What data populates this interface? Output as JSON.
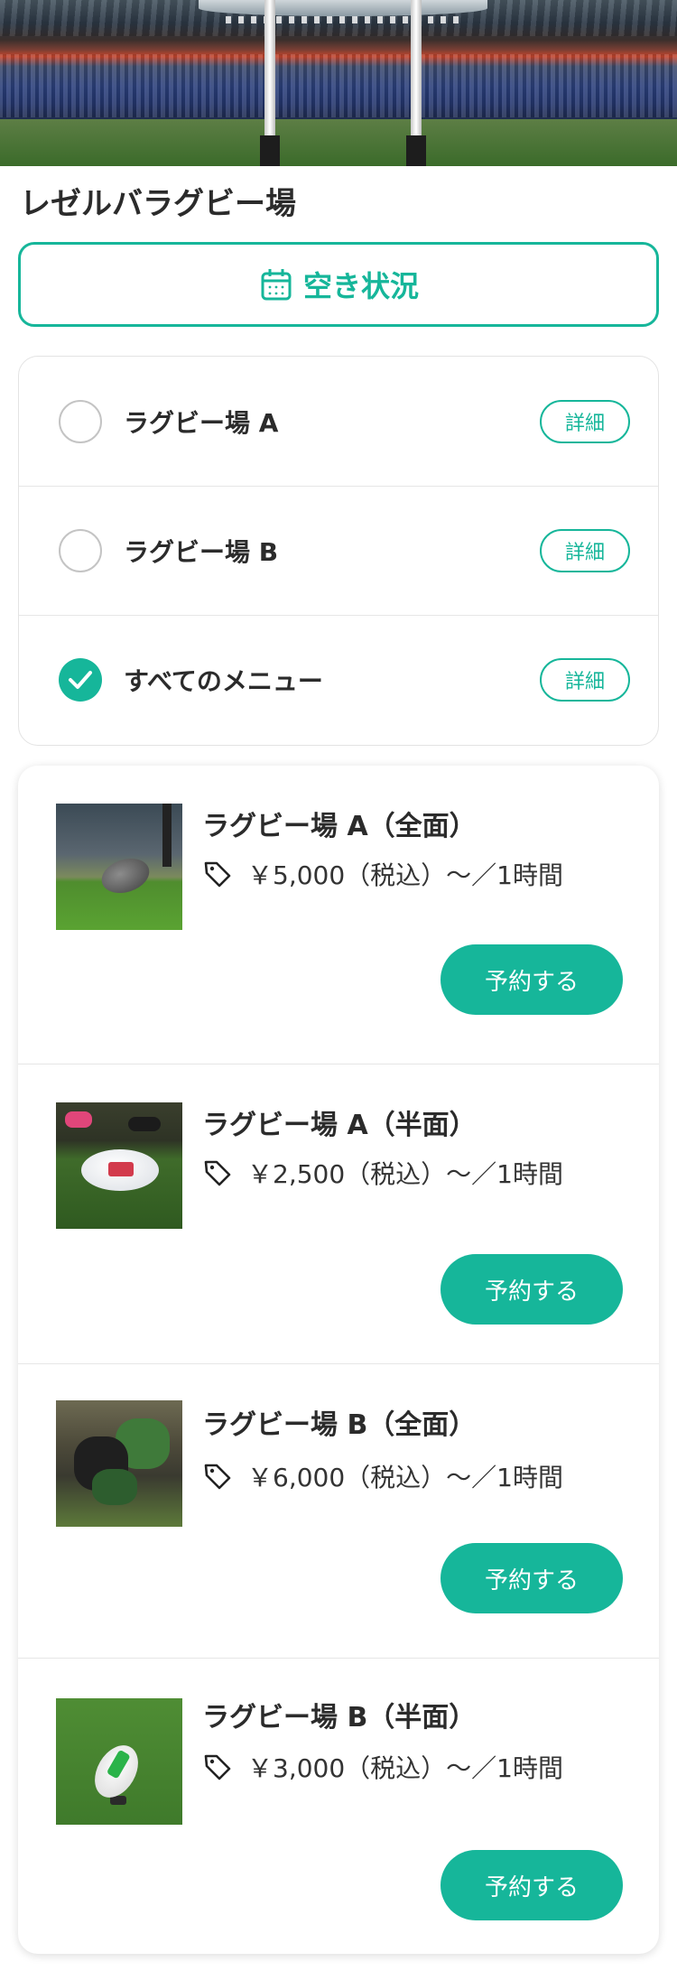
{
  "venue": {
    "name": "レゼルバラグビー場"
  },
  "availability_button": {
    "label": "空き状況",
    "icon": "calendar-icon"
  },
  "accent_color": "#16b69a",
  "course_options": [
    {
      "label": "ラグビー場 A",
      "selected": false,
      "detail_label": "詳細"
    },
    {
      "label": "ラグビー場 B",
      "selected": false,
      "detail_label": "詳細"
    },
    {
      "label": "すべてのメニュー",
      "selected": true,
      "detail_label": "詳細"
    }
  ],
  "menu_items": [
    {
      "name": "ラグビー場 A（全面）",
      "price": "￥5,000（税込）〜／1時間",
      "reserve_label": "予約する",
      "thumbnail": "rugby-ball-on-grass"
    },
    {
      "name": "ラグビー場 A（半面）",
      "price": "￥2,500（税込）〜／1時間",
      "reserve_label": "予約する",
      "thumbnail": "rugby-ball-at-feet"
    },
    {
      "name": "ラグビー場 B（全面）",
      "price": "￥6,000（税込）〜／1時間",
      "reserve_label": "予約する",
      "thumbnail": "rugby-scrum"
    },
    {
      "name": "ラグビー場 B（半面）",
      "price": "￥3,000（税込）〜／1時間",
      "reserve_label": "予約する",
      "thumbnail": "rugby-ball-on-tee"
    }
  ]
}
